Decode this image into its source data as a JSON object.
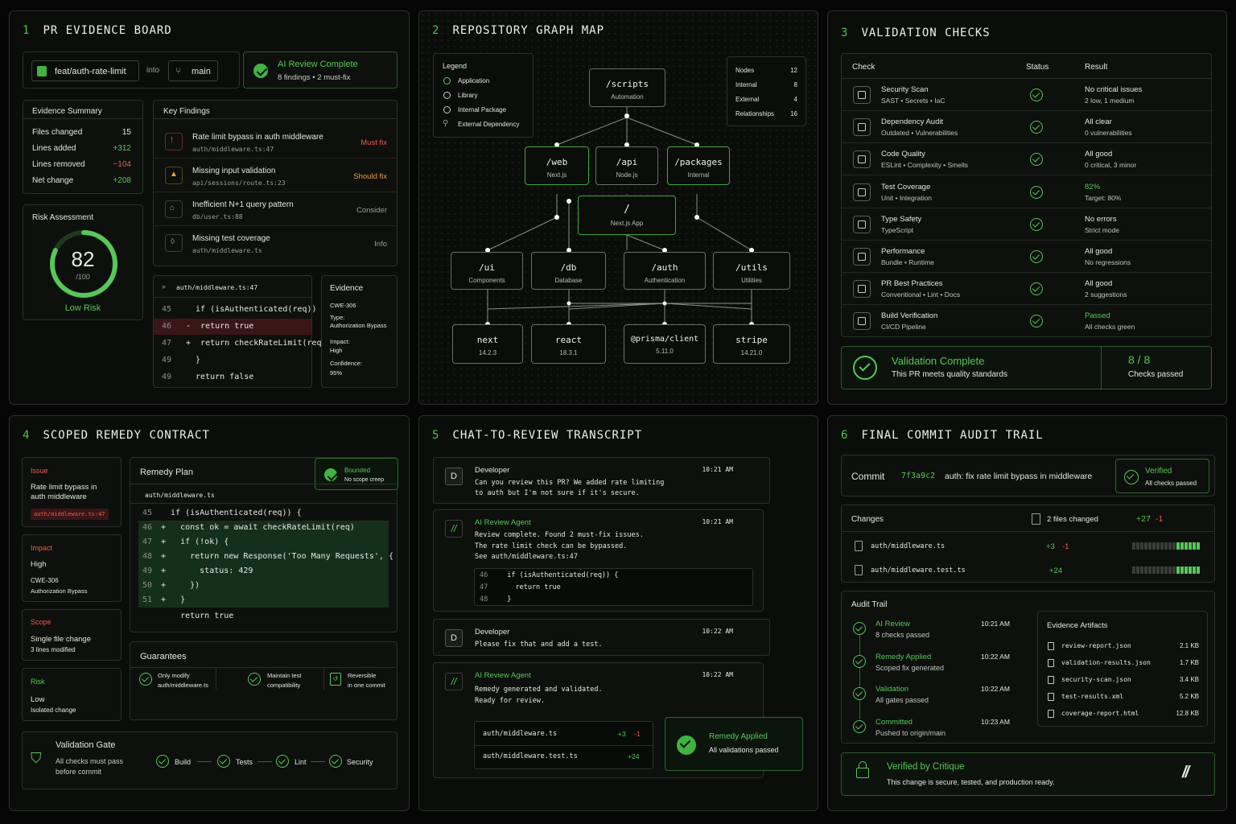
{
  "p1": {
    "num": "1",
    "title": "PR EVIDENCE BOARD",
    "branch": "feat/auth-rate-limit",
    "into": "into",
    "base": "main",
    "ai_title": "AI Review Complete",
    "ai_sub": "8 findings • 2 must-fix",
    "summary": {
      "title": "Evidence Summary",
      "rows": [
        {
          "k": "Files changed",
          "v": "15"
        },
        {
          "k": "Lines added",
          "v": "+312"
        },
        {
          "k": "Lines removed",
          "v": "−104"
        },
        {
          "k": "Net change",
          "v": "+208"
        }
      ]
    },
    "risk": {
      "title": "Risk Assessment",
      "score": "82",
      "of": "/100",
      "label": "Low Risk",
      "score_fraction": 0.82
    },
    "findings": {
      "title": "Key Findings",
      "items": [
        {
          "t": "Rate limit bypass in auth middleware",
          "f": "auth/middleware.ts:47",
          "tag": "Must fix"
        },
        {
          "t": "Missing input validation",
          "f": "api/sessions/route.ts:23",
          "tag": "Should fix"
        },
        {
          "t": "Inefficient N+1 query pattern",
          "f": "db/user.ts:88",
          "tag": "Consider"
        },
        {
          "t": "Missing test coverage",
          "f": "auth/middleware.ts",
          "tag": "Info"
        }
      ]
    },
    "code": {
      "file": "auth/middleware.ts:47",
      "lines": [
        {
          "n": "45",
          "c": "  if (isAuthenticated(req)) {"
        },
        {
          "n": "46",
          "c": "-  return true"
        },
        {
          "n": "47",
          "c": "+  return checkRateLimit(req)"
        },
        {
          "n": "49",
          "c": "  }"
        },
        {
          "n": "49",
          "c": "  return false"
        }
      ]
    },
    "evidence": {
      "title": "Evidence",
      "cwe": "CWE-306",
      "type_k": "Type:",
      "type_v": "Authorization Bypass",
      "impact_k": "Impact:",
      "impact_v": "High",
      "conf_k": "Confidence:",
      "conf_v": "95%"
    }
  },
  "p2": {
    "num": "2",
    "title": "REPOSITORY GRAPH MAP",
    "legend": {
      "title": "Legend",
      "items": [
        "Application",
        "Library",
        "Internal Package",
        "External Dependency"
      ]
    },
    "stats": [
      {
        "k": "Nodes",
        "v": "12"
      },
      {
        "k": "Internal",
        "v": "8"
      },
      {
        "k": "External",
        "v": "4"
      },
      {
        "k": "Relationships",
        "v": "16"
      }
    ],
    "nodes": {
      "scripts": {
        "t": "/scripts",
        "s": "Automation"
      },
      "web": {
        "t": "/web",
        "s": "Next.js"
      },
      "api": {
        "t": "/api",
        "s": "Node.js"
      },
      "packages": {
        "t": "/packages",
        "s": "Internal"
      },
      "root": {
        "t": "/",
        "s": "Next.js App"
      },
      "ui": {
        "t": "/ui",
        "s": "Components"
      },
      "db": {
        "t": "/db",
        "s": "Database"
      },
      "auth": {
        "t": "/auth",
        "s": "Authentication"
      },
      "utils": {
        "t": "/utils",
        "s": "Utilities"
      },
      "next": {
        "t": "next",
        "s": "14.2.3"
      },
      "react": {
        "t": "react",
        "s": "18.3.1"
      },
      "prisma": {
        "t": "@prisma/client",
        "s": "5.11.0"
      },
      "stripe": {
        "t": "stripe",
        "s": "14.21.0"
      }
    }
  },
  "p3": {
    "num": "3",
    "title": "VALIDATION CHECKS",
    "headers": [
      "Check",
      "Status",
      "Result"
    ],
    "rows": [
      {
        "t": "Security Scan",
        "s": "SAST • Secrets • IaC",
        "r1": "No critical issues",
        "r2": "2 low, 1 medium",
        "icon": "security-icon"
      },
      {
        "t": "Dependency Audit",
        "s": "Outdated • Vulnerabilities",
        "r1": "All clear",
        "r2": "0 vulnerabilities",
        "icon": "dependency-icon"
      },
      {
        "t": "Code Quality",
        "s": "ESLint • Complexity • Smells",
        "r1": "All good",
        "r2": "0 critical, 3 minor",
        "icon": "code-quality-icon"
      },
      {
        "t": "Test Coverage",
        "s": "Unit • Integration",
        "r1": "82%",
        "r2": "Target: 80%",
        "icon": "coverage-icon"
      },
      {
        "t": "Type Safety",
        "s": "TypeScript",
        "r1": "No errors",
        "r2": "Strict mode",
        "icon": "type-safety-icon"
      },
      {
        "t": "Performance",
        "s": "Bundle • Runtime",
        "r1": "All good",
        "r2": "No regressions",
        "icon": "performance-icon"
      },
      {
        "t": "PR Best Practices",
        "s": "Conventional • Lint • Docs",
        "r1": "All good",
        "r2": "2 suggestions",
        "icon": "practices-icon"
      },
      {
        "t": "Build Verification",
        "s": "CI/CD Pipeline",
        "r1": "Passed",
        "r2": "All checks green",
        "icon": "build-icon"
      }
    ],
    "complete_title": "Validation Complete",
    "complete_sub": "This PR meets quality standards",
    "count": "8 / 8",
    "count_sub": "Checks passed"
  },
  "p4": {
    "num": "4",
    "title": "SCOPED REMEDY CONTRACT",
    "issue": {
      "label": "Issue",
      "text": "Rate limit bypass in auth middleware",
      "tag": "auth/middleware.ts:47"
    },
    "impact": {
      "label": "Impact",
      "level": "High",
      "cwe": "CWE-306",
      "type": "Authorization Bypass"
    },
    "scope": {
      "label": "Scope",
      "text": "Single file change",
      "sub": "3 lines modified"
    },
    "risk": {
      "label": "Risk",
      "level": "Low",
      "sub": "Isolated change"
    },
    "plan": {
      "title": "Remedy Plan",
      "badge": "Bounded",
      "badge_sub": "No scope creep",
      "file": "auth/middleware.ts",
      "lines": [
        {
          "n": "45",
          "c": "  if (isAuthenticated(req)) {"
        },
        {
          "n": "46",
          "c": "+   const ok = await checkRateLimit(req)"
        },
        {
          "n": "47",
          "c": "+   if (!ok) {"
        },
        {
          "n": "48",
          "c": "+     return new Response('Too Many Requests', {"
        },
        {
          "n": "49",
          "c": "+       status: 429"
        },
        {
          "n": "50",
          "c": "+     })"
        },
        {
          "n": "51",
          "c": "+   }"
        },
        {
          "n": "",
          "c": "    return true"
        }
      ]
    },
    "guarantees": {
      "title": "Guarantees",
      "items": [
        {
          "a": "Only modify",
          "b": "auth/middleware.ts"
        },
        {
          "a": "Maintain test",
          "b": "compatibility"
        },
        {
          "a": "Reversible",
          "b": "in one commit"
        }
      ]
    },
    "gate": {
      "title": "Validation Gate",
      "sub": "All checks must pass before commit",
      "steps": [
        "Build",
        "Tests",
        "Lint",
        "Security"
      ]
    }
  },
  "p5": {
    "num": "5",
    "title": "CHAT-TO-REVIEW TRANSCRIPT",
    "m1": {
      "who": "Developer",
      "time": "10:21 AM",
      "text": "Can you review this PR? We added rate limiting\nto auth but I'm not sure if it's secure."
    },
    "m2": {
      "who": "AI Review Agent",
      "time": "10:21 AM",
      "text": "Review complete. Found 2 must-fix issues.\nThe rate limit check can be bypassed.\nSee auth/middleware.ts:47",
      "code": [
        {
          "n": "46",
          "c": "  if (isAuthenticated(req)) {"
        },
        {
          "n": "47",
          "c": "    return true"
        },
        {
          "n": "48",
          "c": "  }"
        }
      ]
    },
    "m3": {
      "who": "Developer",
      "time": "10:22 AM",
      "text": "Please fix that and add a test."
    },
    "m4": {
      "who": "AI Review Agent",
      "time": "10:22 AM",
      "text": "Remedy generated and validated.\nReady for review.",
      "files": [
        {
          "f": "auth/middleware.ts",
          "a": "+3",
          "d": "-1"
        },
        {
          "f": "auth/middleware.test.ts",
          "a": "+24",
          "d": ""
        }
      ],
      "badge": "Remedy Applied",
      "badge_sub": "All validations passed"
    },
    "avatar_letter": "D"
  },
  "p6": {
    "num": "6",
    "title": "FINAL COMMIT AUDIT TRAIL",
    "commit_label": "Commit",
    "hash": "7f3a9c2",
    "msg": "auth: fix rate limit bypass in middleware",
    "verified": "Verified",
    "verified_sub": "All checks passed",
    "changes": {
      "title": "Changes",
      "files_changed": "2 files changed",
      "add": "+27",
      "del": "-1",
      "files": [
        {
          "f": "auth/middleware.ts",
          "a": "+3",
          "d": "-1"
        },
        {
          "f": "auth/middleware.test.ts",
          "a": "+24",
          "d": ""
        }
      ]
    },
    "audit": {
      "title": "Audit Trail",
      "items": [
        {
          "t": "AI Review",
          "s": "8 checks passed",
          "time": "10:21 AM"
        },
        {
          "t": "Remedy Applied",
          "s": "Scoped fix generated",
          "time": "10:22 AM"
        },
        {
          "t": "Validation",
          "s": "All gates passed",
          "time": "10:22 AM"
        },
        {
          "t": "Committed",
          "s": "Pushed to origin/main",
          "time": "10:23 AM"
        }
      ]
    },
    "artifacts": {
      "title": "Evidence Artifacts",
      "items": [
        {
          "f": "review-report.json",
          "s": "2.1 KB"
        },
        {
          "f": "validation-results.json",
          "s": "1.7 KB"
        },
        {
          "f": "security-scan.json",
          "s": "3.4 KB"
        },
        {
          "f": "test-results.xml",
          "s": "5.2 KB"
        },
        {
          "f": "coverage-report.html",
          "s": "12.8 KB"
        }
      ]
    },
    "critique": {
      "title": "Verified by Critique",
      "sub": "This change is secure, tested, and production ready.",
      "logo": "//"
    }
  },
  "colors": {
    "accent": "#55c955",
    "danger": "#f05a4e",
    "warning": "#f0a030",
    "bg": "#050605"
  }
}
